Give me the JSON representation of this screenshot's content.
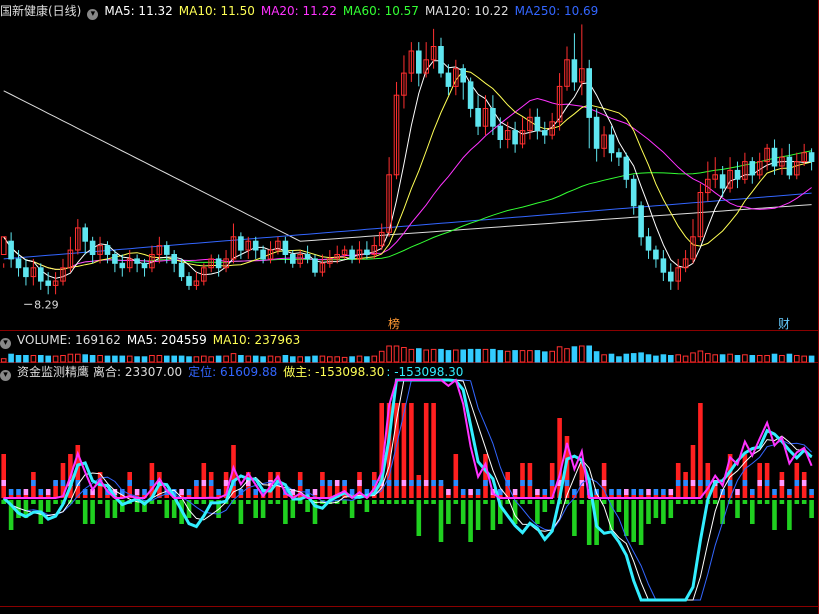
{
  "colors": {
    "up": "#ff3030",
    "down": "#5fe6f0",
    "bg": "#000000",
    "divider": "#8a0000",
    "ma5": "#ffffff",
    "ma10": "#ffff55",
    "ma20": "#ff33ff",
    "ma60": "#33ff33",
    "ma120": "#dddddd",
    "ma250": "#3366ff",
    "vol_up": "#ff3030",
    "vol_down": "#33ccff",
    "fund_pos": "#ff2020",
    "fund_neg": "#20d020",
    "fund_blue": "#2a8cff",
    "fund_pink": "#ff99ff",
    "fund_line1": "#ff33ff",
    "fund_line2": "#33eeff",
    "fund_line3": "#ffffff",
    "fund_line4": "#3366ff"
  },
  "header": {
    "stock_name": "国新健康(日线)",
    "ma5": "MA5: 11.32",
    "ma10": "MA10: 11.50",
    "ma20": "MA20: 11.22",
    "ma60": "MA60: 10.57",
    "ma120": "MA120: 10.22",
    "ma250": "MA250: 10.69"
  },
  "volume_header": {
    "volume": "VOLUME: 169162",
    "ma5": "MA5: 204559",
    "ma10": "MA10: 237963"
  },
  "indicator_header": {
    "name": "资金监测精鹰",
    "lihe": "离合: 23307.00",
    "dingwei": "定位: 61609.88",
    "zuozhu": "做主: -153098.30",
    "extra": ": -153098.30"
  },
  "markers": {
    "bang": "榜",
    "cai": "财",
    "low_label": "8.29"
  },
  "icons": {
    "menu": "chevron-down-icon"
  },
  "chart_data": {
    "type": "candlestick",
    "y_range_price": [
      7.9,
      14.5
    ],
    "candles": [
      [
        9.2,
        9.6,
        9.0,
        8.9
      ],
      [
        9.5,
        9.1,
        9.7,
        8.9
      ],
      [
        9.1,
        8.9,
        9.3,
        8.7
      ],
      [
        8.9,
        8.7,
        9.1,
        8.5
      ],
      [
        8.7,
        8.9,
        9.1,
        8.5
      ],
      [
        8.9,
        8.6,
        9.0,
        8.4
      ],
      [
        8.6,
        8.5,
        8.8,
        8.3
      ],
      [
        8.5,
        8.6,
        8.8,
        8.3
      ],
      [
        8.6,
        8.9,
        9.1,
        8.5
      ],
      [
        8.9,
        9.3,
        9.6,
        8.8
      ],
      [
        9.3,
        9.8,
        10.0,
        9.2
      ],
      [
        9.8,
        9.5,
        9.9,
        9.2
      ],
      [
        9.5,
        9.2,
        9.6,
        9.0
      ],
      [
        9.2,
        9.4,
        9.6,
        9.0
      ],
      [
        9.4,
        9.2,
        9.5,
        9.0
      ],
      [
        9.2,
        9.0,
        9.3,
        8.8
      ],
      [
        9.0,
        8.9,
        9.2,
        8.7
      ],
      [
        8.9,
        9.1,
        9.3,
        8.8
      ],
      [
        9.1,
        9.0,
        9.2,
        8.8
      ],
      [
        9.0,
        8.9,
        9.1,
        8.7
      ],
      [
        8.9,
        9.2,
        9.4,
        8.8
      ],
      [
        9.2,
        9.4,
        9.6,
        9.0
      ],
      [
        9.4,
        9.2,
        9.5,
        9.0
      ],
      [
        9.2,
        9.0,
        9.3,
        8.8
      ],
      [
        9.0,
        8.7,
        9.1,
        8.6
      ],
      [
        8.7,
        8.5,
        8.8,
        8.4
      ],
      [
        8.5,
        8.6,
        8.8,
        8.4
      ],
      [
        8.6,
        8.9,
        9.0,
        8.5
      ],
      [
        8.9,
        9.1,
        9.2,
        8.8
      ],
      [
        9.1,
        8.9,
        9.2,
        8.7
      ],
      [
        8.9,
        9.1,
        9.3,
        8.8
      ],
      [
        9.1,
        9.6,
        9.9,
        9.0
      ],
      [
        9.6,
        9.3,
        9.7,
        9.1
      ],
      [
        9.3,
        9.5,
        9.6,
        9.1
      ],
      [
        9.5,
        9.3,
        9.6,
        9.1
      ],
      [
        9.3,
        9.1,
        9.4,
        9.0
      ],
      [
        9.1,
        9.3,
        9.5,
        9.0
      ],
      [
        9.3,
        9.5,
        9.6,
        9.2
      ],
      [
        9.5,
        9.2,
        9.6,
        9.0
      ],
      [
        9.2,
        9.0,
        9.3,
        8.9
      ],
      [
        9.0,
        9.2,
        9.3,
        8.9
      ],
      [
        9.2,
        9.1,
        9.4,
        9.0
      ],
      [
        9.1,
        8.8,
        9.2,
        8.7
      ],
      [
        8.8,
        9.0,
        9.2,
        8.7
      ],
      [
        9.0,
        9.1,
        9.3,
        8.9
      ],
      [
        9.1,
        9.2,
        9.4,
        9.0
      ],
      [
        9.2,
        9.3,
        9.4,
        9.1
      ],
      [
        9.3,
        9.1,
        9.4,
        9.0
      ],
      [
        9.1,
        9.3,
        9.5,
        9.0
      ],
      [
        9.3,
        9.2,
        9.5,
        9.1
      ],
      [
        9.2,
        9.4,
        9.6,
        9.1
      ],
      [
        9.4,
        9.7,
        9.9,
        9.3
      ],
      [
        9.7,
        11.0,
        11.4,
        9.6
      ],
      [
        11.0,
        12.8,
        13.1,
        10.9
      ],
      [
        12.8,
        13.3,
        13.7,
        12.5
      ],
      [
        13.3,
        13.8,
        14.0,
        13.1
      ],
      [
        13.8,
        13.3,
        14.0,
        13.0
      ],
      [
        13.3,
        13.6,
        14.0,
        13.2
      ],
      [
        13.6,
        13.9,
        14.3,
        13.4
      ],
      [
        13.9,
        13.3,
        14.1,
        13.2
      ],
      [
        13.3,
        13.0,
        13.5,
        12.8
      ],
      [
        13.0,
        13.4,
        13.6,
        12.8
      ],
      [
        13.4,
        13.1,
        13.5,
        12.7
      ],
      [
        13.1,
        12.5,
        13.2,
        12.3
      ],
      [
        12.5,
        12.1,
        12.8,
        11.9
      ],
      [
        12.1,
        12.5,
        12.8,
        11.9
      ],
      [
        12.5,
        12.1,
        12.8,
        11.9
      ],
      [
        12.1,
        11.8,
        12.3,
        11.6
      ],
      [
        11.8,
        12.0,
        12.2,
        11.6
      ],
      [
        12.0,
        11.7,
        12.2,
        11.5
      ],
      [
        11.7,
        12.0,
        12.3,
        11.6
      ],
      [
        12.0,
        12.3,
        12.5,
        11.8
      ],
      [
        12.3,
        12.0,
        12.5,
        11.8
      ],
      [
        12.0,
        11.9,
        12.2,
        11.7
      ],
      [
        11.9,
        12.2,
        12.4,
        11.8
      ],
      [
        12.2,
        13.0,
        13.3,
        12.0
      ],
      [
        13.0,
        13.6,
        13.9,
        12.9
      ],
      [
        13.6,
        13.1,
        14.2,
        12.9
      ],
      [
        13.1,
        13.4,
        14.4,
        12.8
      ],
      [
        13.4,
        12.3,
        13.6,
        11.6
      ],
      [
        12.3,
        11.6,
        12.5,
        11.3
      ],
      [
        11.6,
        11.9,
        12.1,
        11.4
      ],
      [
        11.9,
        11.5,
        12.1,
        11.3
      ],
      [
        11.5,
        11.4,
        11.6,
        11.2
      ],
      [
        11.4,
        10.9,
        11.5,
        10.7
      ],
      [
        10.9,
        10.3,
        11.0,
        10.1
      ],
      [
        10.3,
        9.6,
        10.4,
        9.4
      ],
      [
        9.6,
        9.3,
        9.8,
        9.1
      ],
      [
        9.3,
        9.1,
        9.4,
        8.9
      ],
      [
        9.1,
        8.8,
        9.3,
        8.6
      ],
      [
        8.8,
        8.6,
        9.0,
        8.4
      ],
      [
        8.6,
        8.9,
        9.1,
        8.4
      ],
      [
        8.9,
        9.1,
        9.3,
        8.8
      ],
      [
        9.1,
        9.6,
        10.0,
        9.0
      ],
      [
        9.6,
        10.6,
        10.8,
        9.5
      ],
      [
        10.6,
        10.9,
        11.3,
        10.4
      ],
      [
        10.9,
        11.0,
        11.4,
        10.7
      ],
      [
        11.0,
        10.7,
        11.2,
        10.5
      ],
      [
        10.7,
        11.1,
        11.4,
        10.6
      ],
      [
        11.1,
        10.9,
        11.3,
        10.7
      ],
      [
        10.9,
        11.3,
        11.5,
        10.8
      ],
      [
        11.3,
        11.0,
        11.4,
        10.8
      ],
      [
        11.0,
        11.3,
        11.5,
        10.9
      ],
      [
        11.3,
        11.6,
        11.7,
        11.1
      ],
      [
        11.6,
        11.2,
        11.8,
        11.0
      ],
      [
        11.2,
        11.4,
        11.6,
        11.0
      ],
      [
        11.4,
        11.0,
        11.7,
        10.9
      ],
      [
        11.0,
        11.3,
        11.5,
        10.9
      ],
      [
        11.3,
        11.5,
        11.7,
        11.2
      ],
      [
        11.5,
        11.3,
        11.6,
        11.1
      ]
    ]
  }
}
